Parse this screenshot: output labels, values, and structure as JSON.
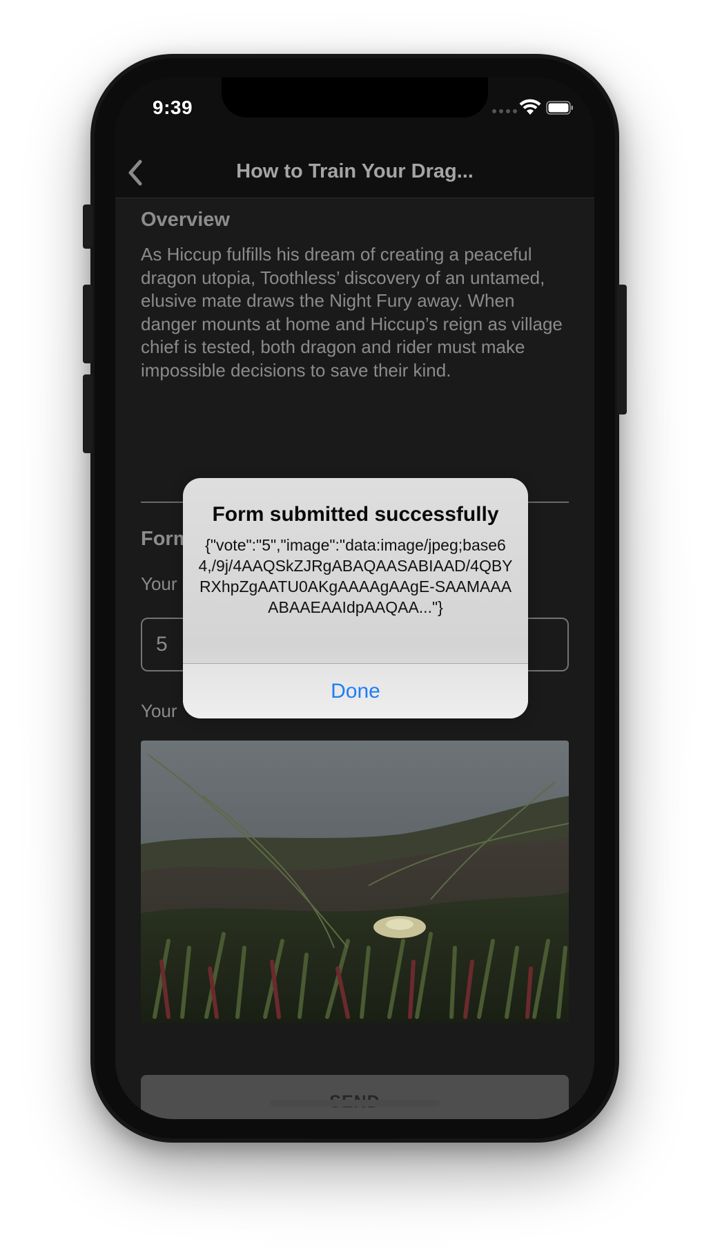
{
  "status_bar": {
    "time": "9:39"
  },
  "nav": {
    "title": "How to Train Your Drag...",
    "back_icon": "chevron-left-icon"
  },
  "overview": {
    "title": "Overview",
    "text": "As Hiccup fulfills his dream of creating a peaceful dragon utopia, Toothless’ discovery of an untamed, elusive mate draws the Night Fury away. When danger mounts at home and Hiccup’s reign as village chief is tested, both dragon and rider must make impossible decisions to save their kind."
  },
  "form": {
    "title": "Form",
    "vote_label": "Your",
    "vote_value": "5",
    "image_label": "Your",
    "send_label": "SEND"
  },
  "alert": {
    "title": "Form submitted successfully",
    "message": "{\"vote\":\"5\",\"image\":\"data:image/jpeg;base64,/9j/4AAQSkZJRgABAQAASABIAAD/4QBYRXhpZgAATU0AKgAAAAgAAgE-SAAMAAAABAAEAAIdpAAQAA...\"}",
    "done_label": "Done"
  },
  "colors": {
    "screen_bg": "#1a1a1a",
    "alert_action": "#1e7ef3",
    "send_bg": "#4e4e4e"
  }
}
